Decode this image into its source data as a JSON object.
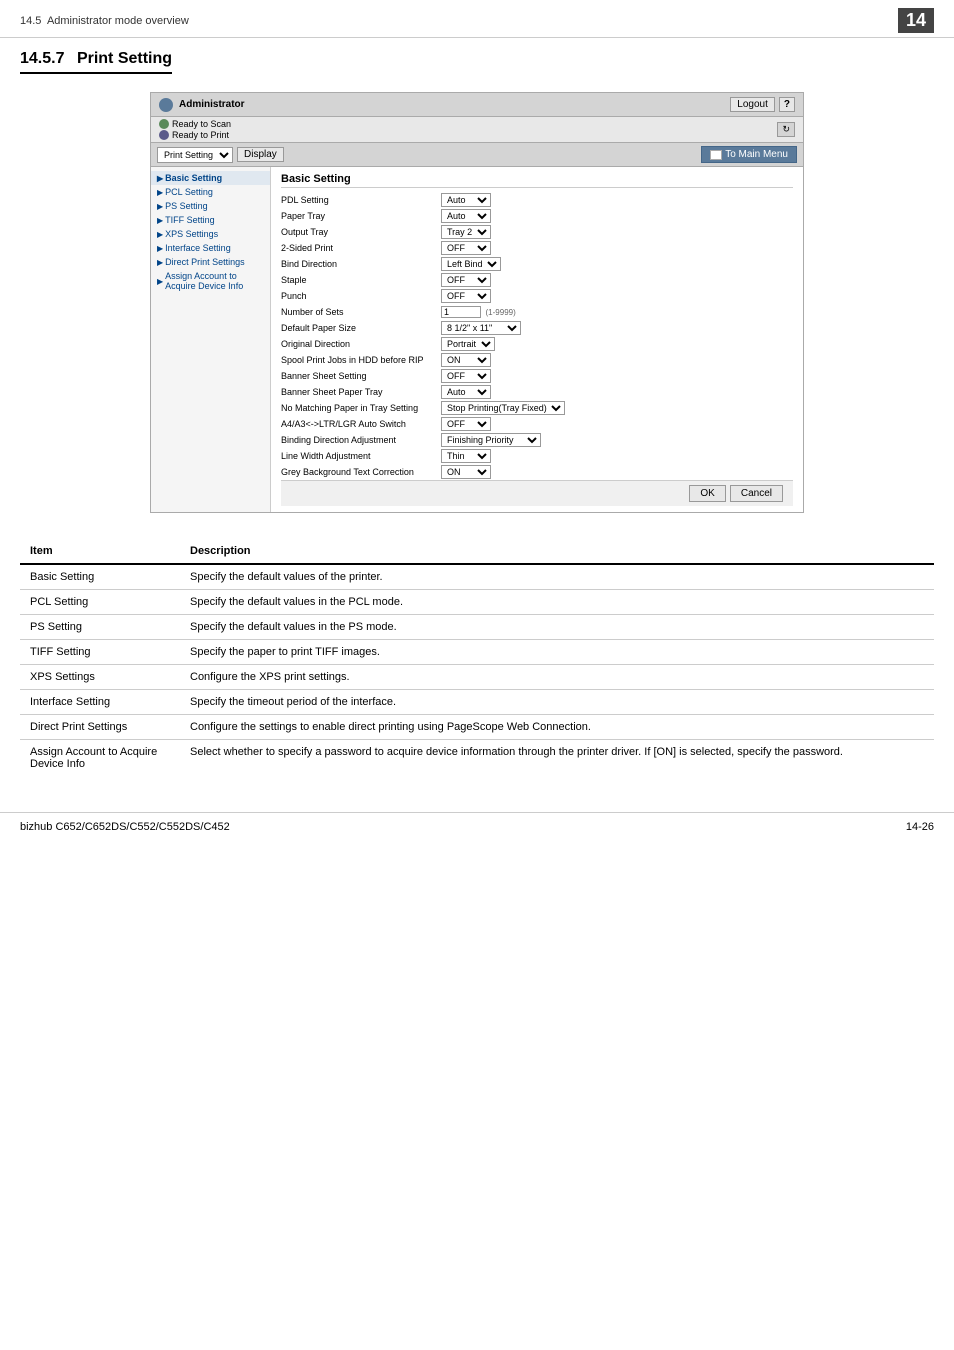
{
  "header": {
    "section": "14.5",
    "section_label": "Administrator mode overview",
    "page_num": "14"
  },
  "section": {
    "number": "14.5.7",
    "title": "Print Setting"
  },
  "screenshot": {
    "admin_label": "Administrator",
    "logout_label": "Logout",
    "help_label": "?",
    "status_scan": "Ready to Scan",
    "status_print": "Ready to Print",
    "refresh_label": "↻",
    "toolbar": {
      "select_value": "Print Setting",
      "display_label": "Display",
      "main_menu_label": "To Main Menu"
    },
    "sidebar": {
      "items": [
        {
          "label": "Basic Setting",
          "active": true
        },
        {
          "label": "PCL Setting",
          "active": false
        },
        {
          "label": "PS Setting",
          "active": false
        },
        {
          "label": "TIFF Setting",
          "active": false
        },
        {
          "label": "XPS Settings",
          "active": false
        },
        {
          "label": "Interface Setting",
          "active": false
        },
        {
          "label": "Direct Print Settings",
          "active": false
        },
        {
          "label": "Assign Account to Acquire Device Info",
          "active": false
        }
      ]
    },
    "form": {
      "title": "Basic Setting",
      "rows": [
        {
          "label": "PDL Setting",
          "value": "Auto",
          "type": "select",
          "options": [
            "Auto"
          ]
        },
        {
          "label": "Paper Tray",
          "value": "Auto",
          "type": "select",
          "options": [
            "Auto"
          ]
        },
        {
          "label": "Output Tray",
          "value": "Tray 2",
          "type": "select",
          "options": [
            "Tray 2"
          ]
        },
        {
          "label": "2-Sided Print",
          "value": "OFF",
          "type": "select",
          "options": [
            "OFF"
          ]
        },
        {
          "label": "Bind Direction",
          "value": "Left Bind",
          "type": "select",
          "options": [
            "Left Bind"
          ]
        },
        {
          "label": "Staple",
          "value": "OFF",
          "type": "select",
          "options": [
            "OFF"
          ]
        },
        {
          "label": "Punch",
          "value": "OFF",
          "type": "select",
          "options": [
            "OFF"
          ]
        },
        {
          "label": "Number of Sets",
          "value": "1",
          "type": "input",
          "hint": "(1-9999)"
        },
        {
          "label": "Default Paper Size",
          "value": "8 1/2\" x 11\"",
          "type": "select",
          "options": [
            "8 1/2\" x 11\""
          ]
        },
        {
          "label": "Original Direction",
          "value": "Portrait",
          "type": "select",
          "options": [
            "Portrait"
          ]
        },
        {
          "label": "Spool Print Jobs in HDD before RIP",
          "value": "ON",
          "type": "select",
          "options": [
            "ON"
          ]
        },
        {
          "label": "Banner Sheet Setting",
          "value": "OFF",
          "type": "select",
          "options": [
            "OFF"
          ]
        },
        {
          "label": "Banner Sheet Paper Tray",
          "value": "Auto",
          "type": "select",
          "options": [
            "Auto"
          ]
        },
        {
          "label": "No Matching Paper in Tray Setting",
          "value": "Stop Printing(Tray Fixed)",
          "type": "select",
          "options": [
            "Stop Printing(Tray Fixed)"
          ]
        },
        {
          "label": "A4/A3<->LTR/LGR Auto Switch",
          "value": "OFF",
          "type": "select",
          "options": [
            "OFF"
          ]
        },
        {
          "label": "Binding Direction Adjustment",
          "value": "Finishing Priority",
          "type": "select",
          "options": [
            "Finishing Priority"
          ]
        },
        {
          "label": "Line Width Adjustment",
          "value": "Thin",
          "type": "select",
          "options": [
            "Thin"
          ]
        },
        {
          "label": "Grey Background Text Correction",
          "value": "ON",
          "type": "select",
          "options": [
            "ON"
          ]
        }
      ],
      "ok_label": "OK",
      "cancel_label": "Cancel"
    }
  },
  "table": {
    "col_item": "Item",
    "col_desc": "Description",
    "rows": [
      {
        "item": "Basic Setting",
        "desc": "Specify the default values of the printer."
      },
      {
        "item": "PCL Setting",
        "desc": "Specify the default values in the PCL mode."
      },
      {
        "item": "PS Setting",
        "desc": "Specify the default values in the PS mode."
      },
      {
        "item": "TIFF Setting",
        "desc": "Specify the paper to print TIFF images."
      },
      {
        "item": "XPS Settings",
        "desc": "Configure the XPS print settings."
      },
      {
        "item": "Interface Setting",
        "desc": "Specify the timeout period of the interface."
      },
      {
        "item": "Direct Print Settings",
        "desc": "Configure the settings to enable direct printing using PageScope Web Connection."
      },
      {
        "item": "Assign Account to Acquire Device Info",
        "desc": "Select whether to specify a password to acquire device information through the printer driver. If [ON] is selected, specify the password."
      }
    ]
  },
  "footer": {
    "left": "bizhub C652/C652DS/C552/C552DS/C452",
    "right": "14-26"
  }
}
